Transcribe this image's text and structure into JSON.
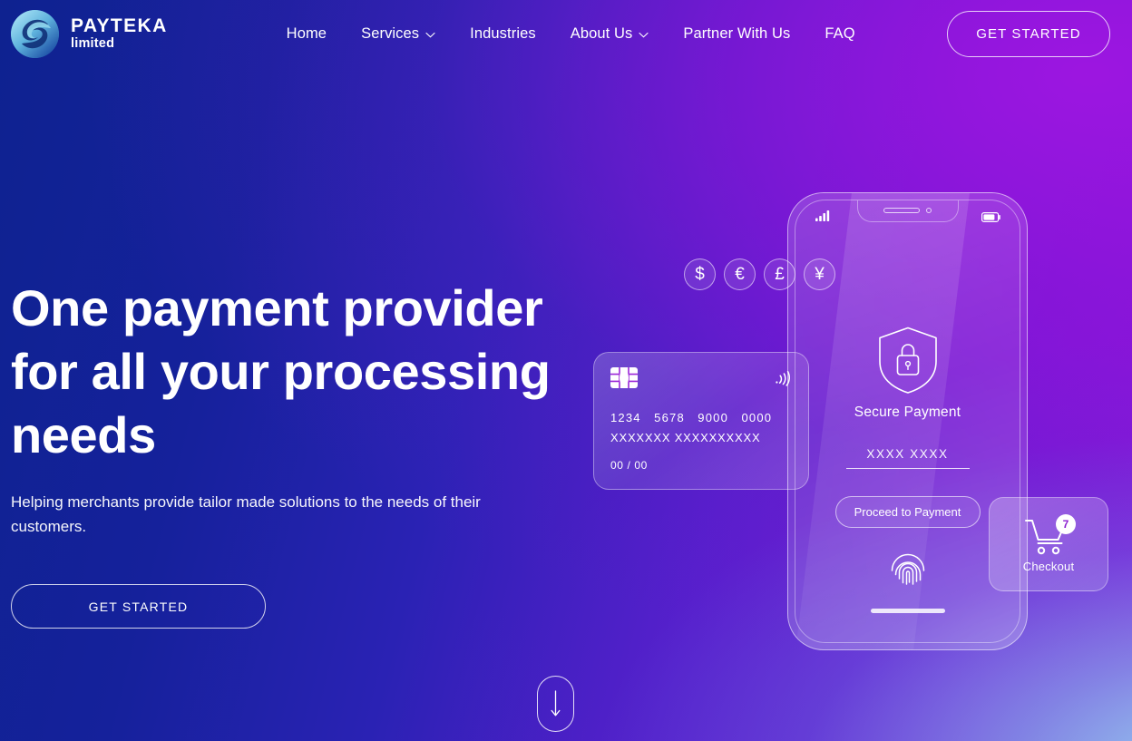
{
  "brand": {
    "logo_icon": "payteka-swirl-logo-icon",
    "name": "PAYTEKA",
    "subtitle": "limited"
  },
  "nav": {
    "items": [
      {
        "label": "Home",
        "has_caret": false
      },
      {
        "label": "Services",
        "has_caret": true
      },
      {
        "label": "Industries",
        "has_caret": false
      },
      {
        "label": "About Us",
        "has_caret": true
      },
      {
        "label": "Partner With Us",
        "has_caret": false
      },
      {
        "label": "FAQ",
        "has_caret": false
      }
    ],
    "cta_label": "GET STARTED"
  },
  "hero": {
    "title": "One payment provider for all your processing needs",
    "subtitle": "Helping merchants provide tailor made solutions to the needs of their customers.",
    "cta_label": "GET STARTED",
    "scroll_hint_icon": "scroll-down-arrow-icon"
  },
  "illustration": {
    "phone": {
      "status": {
        "signal_icon": "signal-bars-icon",
        "battery_icon": "battery-icon",
        "speaker_icon": "earpiece-speaker-icon",
        "camera_icon": "front-camera-icon"
      },
      "currencies": [
        {
          "symbol": "$",
          "name": "dollar"
        },
        {
          "symbol": "€",
          "name": "euro"
        },
        {
          "symbol": "£",
          "name": "pound"
        },
        {
          "symbol": "¥",
          "name": "yen"
        }
      ],
      "secure": {
        "icon": "shield-lock-icon",
        "label": "Secure Payment",
        "pin_value": "XXXX XXXX",
        "proceed_label": "Proceed to Payment"
      },
      "fingerprint_icon": "fingerprint-icon",
      "home_indicator": "home-indicator-bar"
    },
    "card": {
      "chip_icon": "card-chip-icon",
      "contactless_icon": "contactless-payment-icon",
      "number": "1234   5678   9000   0000",
      "holder": "XXXXXXX  XXXXXXXXXX",
      "expiry": "00 / 00"
    },
    "checkout": {
      "cart_icon": "shopping-cart-icon",
      "badge_count": "7",
      "label": "Checkout"
    }
  },
  "colors": {
    "gradient_start": "#0e2290",
    "gradient_mid": "#5a1ccd",
    "gradient_end": "#9b11e0",
    "gradient_corner_light": "#96def0",
    "text": "#ffffff",
    "badge_text": "#8b1fd0"
  }
}
